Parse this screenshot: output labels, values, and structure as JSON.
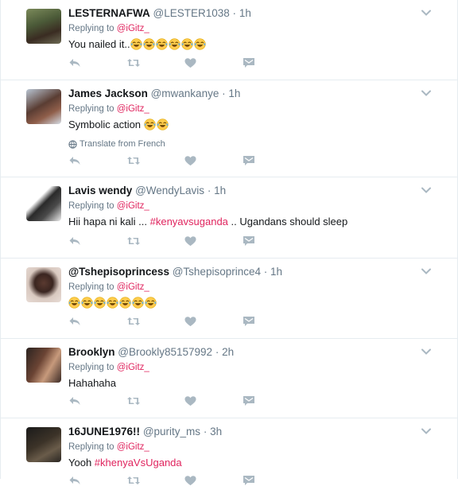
{
  "colors": {
    "accent": "#e0245e",
    "meta": "#657786",
    "icon": "#aab8c2",
    "border": "#e6ecf0"
  },
  "icons": {
    "reply": "reply-icon",
    "retweet": "retweet-icon",
    "like": "heart-icon",
    "dm": "direct-message-icon",
    "more": "chevron-down-icon",
    "translate": "globe-icon",
    "emoji": "tears-of-joy-emoji"
  },
  "tweets": [
    {
      "name": "LESTERNAFWA",
      "handle": "@LESTER1038",
      "dot": "·",
      "time": "1h",
      "replying_prefix": "Replying to ",
      "replying_to": "@iGitz_",
      "text": "You nailed it..",
      "hashtag": "",
      "text_after": "",
      "emoji_count": 6
    },
    {
      "name": "James Jackson",
      "handle": "@mwankanye",
      "dot": "·",
      "time": "1h",
      "replying_prefix": "Replying to ",
      "replying_to": "@iGitz_",
      "text": "Symbolic action ",
      "hashtag": "",
      "text_after": "",
      "emoji_count": 2,
      "translate": "Translate from French"
    },
    {
      "name": "Lavis wendy",
      "handle": "@WendyLavis",
      "dot": "·",
      "time": "1h",
      "replying_prefix": "Replying to ",
      "replying_to": "@iGitz_",
      "text": "Hii hapa ni kali ... ",
      "hashtag": "#kenyavsuganda",
      "text_after": " .. Ugandans should sleep",
      "emoji_count": 0
    },
    {
      "name": "@Tshepisoprincess",
      "handle": "@Tshepisoprince4",
      "dot": "·",
      "time": "1h",
      "replying_prefix": "Replying to ",
      "replying_to": "@iGitz_",
      "text": "",
      "hashtag": "",
      "text_after": "",
      "emoji_count": 7
    },
    {
      "name": "Brooklyn",
      "handle": "@Brookly85157992",
      "dot": "·",
      "time": "2h",
      "replying_prefix": "Replying to ",
      "replying_to": "@iGitz_",
      "text": "Hahahaha",
      "hashtag": "",
      "text_after": "",
      "emoji_count": 0
    },
    {
      "name": "16JUNE1976!!",
      "handle": "@purity_ms",
      "dot": "·",
      "time": "3h",
      "replying_prefix": "Replying to ",
      "replying_to": "@iGitz_",
      "text": "Yooh ",
      "hashtag": "#khenyaVsUganda",
      "text_after": "",
      "emoji_count": 0
    }
  ]
}
